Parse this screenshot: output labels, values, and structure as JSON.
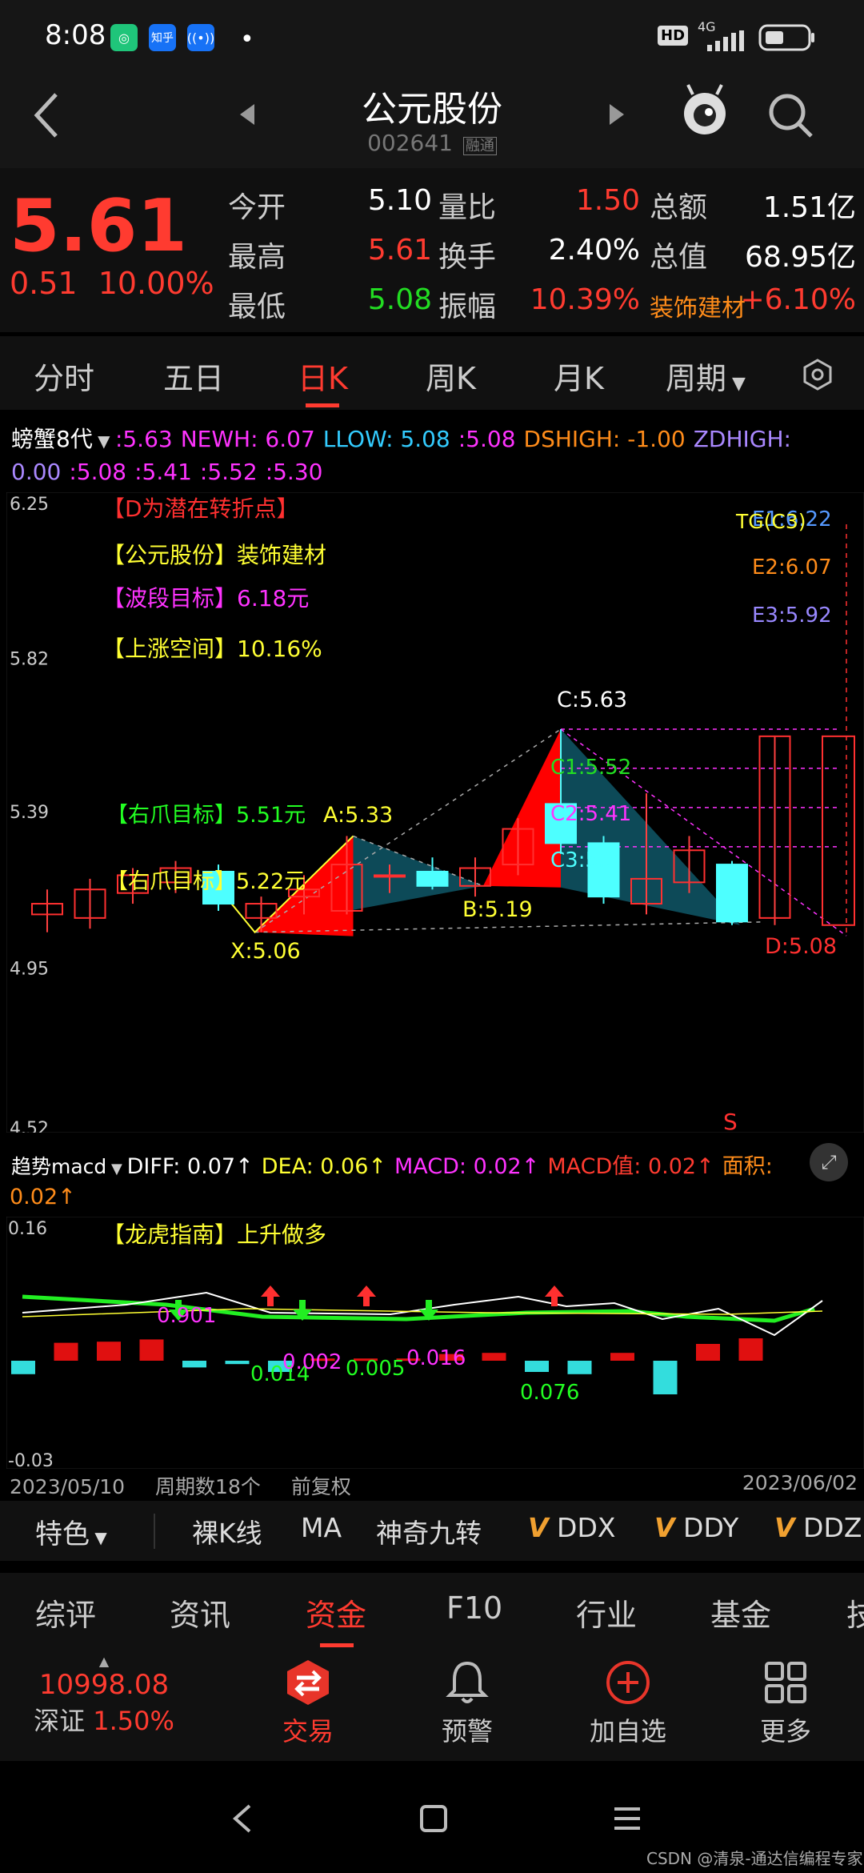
{
  "status": {
    "time": "8:08",
    "app_icons": [
      "知乎"
    ],
    "network": "4G",
    "hd": "HD"
  },
  "header": {
    "name": "公元股份",
    "code": "002641",
    "tag": "融通"
  },
  "quote": {
    "price": "5.61",
    "change": "0.51",
    "change_pct": "10.00%",
    "rows": [
      [
        {
          "label": "今开",
          "value": "5.10",
          "color": "#ffffff"
        },
        {
          "label": "量比",
          "value": "1.50",
          "color": "#ff3b30"
        },
        {
          "label": "总额",
          "value": "1.51亿",
          "color": "#ffffff"
        }
      ],
      [
        {
          "label": "最高",
          "value": "5.61",
          "color": "#ff3b30"
        },
        {
          "label": "换手",
          "value": "2.40%",
          "color": "#ffffff"
        },
        {
          "label": "总值",
          "value": "68.95亿",
          "color": "#ffffff"
        }
      ],
      [
        {
          "label": "最低",
          "value": "5.08",
          "color": "#22dd22"
        },
        {
          "label": "振幅",
          "value": "10.39%",
          "color": "#ff3b30"
        },
        {
          "label": "装饰建材",
          "value": "+6.10%",
          "color": "#ff3b30"
        }
      ]
    ]
  },
  "tabs": [
    "分时",
    "五日",
    "日K",
    "周K",
    "月K",
    "周期"
  ],
  "active_tab": "日K",
  "indicator1": {
    "name": "螃蟹8代",
    "items": [
      {
        "t": ":5.63",
        "c": "#ff33ff"
      },
      {
        "t": "NEWH: 6.07",
        "c": "#ff33ff"
      },
      {
        "t": "LLOW: 5.08",
        "c": "#33ccff"
      },
      {
        "t": ":5.08",
        "c": "#ff33ff"
      },
      {
        "t": "DSHIGH: -1.00",
        "c": "#ff8c1a"
      },
      {
        "t": "ZDHIGH:",
        "c": "#aa88ff"
      }
    ],
    "items2": [
      {
        "t": "0.00",
        "c": "#aa88ff"
      },
      {
        "t": ":5.08",
        "c": "#ff33ff"
      },
      {
        "t": ":5.41",
        "c": "#ff33ff"
      },
      {
        "t": ":5.52",
        "c": "#ff33ff"
      },
      {
        "t": ":5.30",
        "c": "#ff33ff"
      }
    ]
  },
  "kchart": {
    "yticks": [
      "6.25",
      "5.82",
      "5.39",
      "4.95",
      "4.52"
    ],
    "notes": [
      {
        "t": "【D为潜在转折点】",
        "c": "#ff3030"
      },
      {
        "t": "【公元股份】装饰建材",
        "c": "#ffff33"
      },
      {
        "t": "【波段目标】6.18元",
        "c": "#ff33ff"
      },
      {
        "t": "【上涨空间】10.16%",
        "c": "#ffff33"
      }
    ],
    "claw1": "【右爪目标】5.51元",
    "claw2": "【右爪目标】5.22元",
    "points": {
      "X": "X:5.06",
      "A": "A:5.33",
      "B": "B:5.19",
      "C": "C:5.63",
      "D": "D:5.08"
    },
    "c_levels": [
      "C1:5.52",
      "C2:5.41",
      "C3:5.3"
    ],
    "e_levels": [
      "E1:6.22",
      "E2:6.07",
      "E3:5.92"
    ],
    "tg": "TG(C3)",
    "s_mark": "S"
  },
  "chart_data": {
    "type": "candlestick",
    "ylim": [
      4.52,
      6.25
    ],
    "candles": [
      {
        "o": 5.11,
        "c": 5.14,
        "h": 5.18,
        "l": 5.06
      },
      {
        "o": 5.1,
        "c": 5.18,
        "h": 5.21,
        "l": 5.07
      },
      {
        "o": 5.17,
        "c": 5.22,
        "h": 5.24,
        "l": 5.14
      },
      {
        "o": 5.2,
        "c": 5.24,
        "h": 5.26,
        "l": 5.17
      },
      {
        "o": 5.23,
        "c": 5.14,
        "h": 5.25,
        "l": 5.12
      },
      {
        "o": 5.1,
        "c": 5.14,
        "h": 5.16,
        "l": 5.06
      },
      {
        "o": 5.16,
        "c": 5.18,
        "h": 5.22,
        "l": 5.11
      },
      {
        "o": 5.12,
        "c": 5.25,
        "h": 5.33,
        "l": 5.11
      },
      {
        "o": 5.22,
        "c": 5.22,
        "h": 5.25,
        "l": 5.17
      },
      {
        "o": 5.23,
        "c": 5.19,
        "h": 5.27,
        "l": 5.18
      },
      {
        "o": 5.19,
        "c": 5.24,
        "h": 5.27,
        "l": 5.16
      },
      {
        "o": 5.25,
        "c": 5.35,
        "h": 5.38,
        "l": 5.22
      },
      {
        "o": 5.42,
        "c": 5.31,
        "h": 5.63,
        "l": 5.28
      },
      {
        "o": 5.31,
        "c": 5.16,
        "h": 5.33,
        "l": 5.14
      },
      {
        "o": 5.14,
        "c": 5.21,
        "h": 5.45,
        "l": 5.11
      },
      {
        "o": 5.2,
        "c": 5.29,
        "h": 5.33,
        "l": 5.17
      },
      {
        "o": 5.25,
        "c": 5.09,
        "h": 5.26,
        "l": 5.08
      },
      {
        "o": 5.1,
        "c": 5.61,
        "h": 5.61,
        "l": 5.08
      }
    ]
  },
  "macd": {
    "name": "趋势macd",
    "items": [
      {
        "t": "DIFF: 0.07↑",
        "c": "#ffffff"
      },
      {
        "t": "DEA: 0.06↑",
        "c": "#ffff33"
      },
      {
        "t": "MACD: 0.02↑",
        "c": "#ff33ff"
      },
      {
        "t": "MACD值: 0.02↑",
        "c": "#ff3b30"
      },
      {
        "t": "面积:",
        "c": "#ff8c1a"
      }
    ],
    "area": "0.02↑",
    "top": "0.16",
    "bottom": "-0.03",
    "note": "【龙虎指南】上升做多",
    "labels": [
      {
        "t": "0.901",
        "c": "#ff33ff"
      },
      {
        "t": "0.014",
        "c": "#22ff22"
      },
      {
        "t": "0.002",
        "c": "#ff33ff"
      },
      {
        "t": "0.005",
        "c": "#22ff22"
      },
      {
        "t": "0.016",
        "c": "#ff33ff"
      },
      {
        "t": "0.076",
        "c": "#22ff22"
      }
    ],
    "bars": [
      -0.012,
      0.016,
      0.017,
      0.019,
      -0.006,
      -0.003,
      -0.01,
      0.002,
      0.002,
      0.002,
      0.006,
      0.007,
      -0.01,
      -0.012,
      0.007,
      -0.03,
      0.015,
      0.02
    ],
    "date_start": "2023/05/10",
    "period_count": "周期数18个",
    "fuquan": "前复权",
    "date_end": "2023/06/02"
  },
  "feature_bar": {
    "label": "特色",
    "items": [
      "裸K线",
      "MA",
      "神奇九转",
      "DDX",
      "DDY",
      "DDZ"
    ],
    "v": "V"
  },
  "bottom_tabs": [
    "综评",
    "资讯",
    "资金",
    "F10",
    "行业",
    "基金",
    "技"
  ],
  "bottom_active": "资金",
  "nav": {
    "index_value": "10998.08",
    "index_name": "深证",
    "index_pct": "1.50%",
    "items": [
      "交易",
      "预警",
      "加自选",
      "更多"
    ]
  },
  "watermark": "CSDN @清泉-通达信编程专家"
}
